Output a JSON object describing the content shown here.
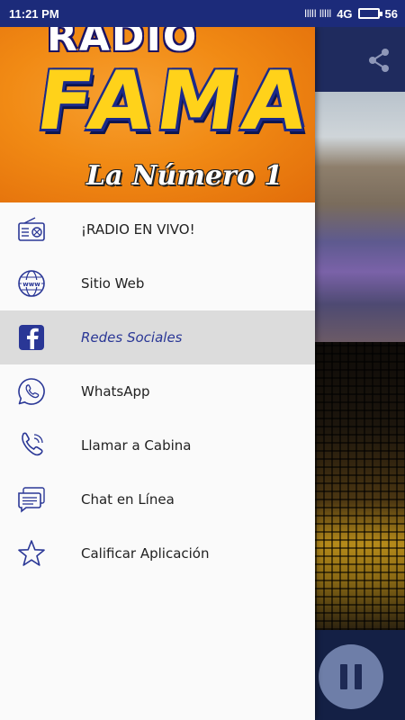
{
  "status": {
    "time": "11:21 PM",
    "signal": "lllll lllll",
    "network": "4G",
    "battery": "56"
  },
  "header": {
    "logo_top": "RADIO",
    "logo_main": "FAMA",
    "logo_tagline": "La Número 1"
  },
  "menu": {
    "items": [
      {
        "label": "¡RADIO EN VIVO!",
        "icon": "radio-icon"
      },
      {
        "label": "Sitio Web",
        "icon": "globe-www-icon"
      },
      {
        "label": "Redes Sociales",
        "icon": "facebook-icon",
        "active": true
      },
      {
        "label": "WhatsApp",
        "icon": "whatsapp-icon"
      },
      {
        "label": "Llamar a Cabina",
        "icon": "phone-icon"
      },
      {
        "label": "Chat en Línea",
        "icon": "chat-icon"
      },
      {
        "label": "Calificar Aplicación",
        "icon": "star-icon"
      }
    ]
  },
  "player": {
    "state_icon": "pause-icon"
  },
  "colors": {
    "status_bar": "#1c2b7a",
    "accent": "#2a3796",
    "header_orange": "#f18a14",
    "logo_yellow": "#ffd21a",
    "active_row": "#dcdcdc"
  }
}
